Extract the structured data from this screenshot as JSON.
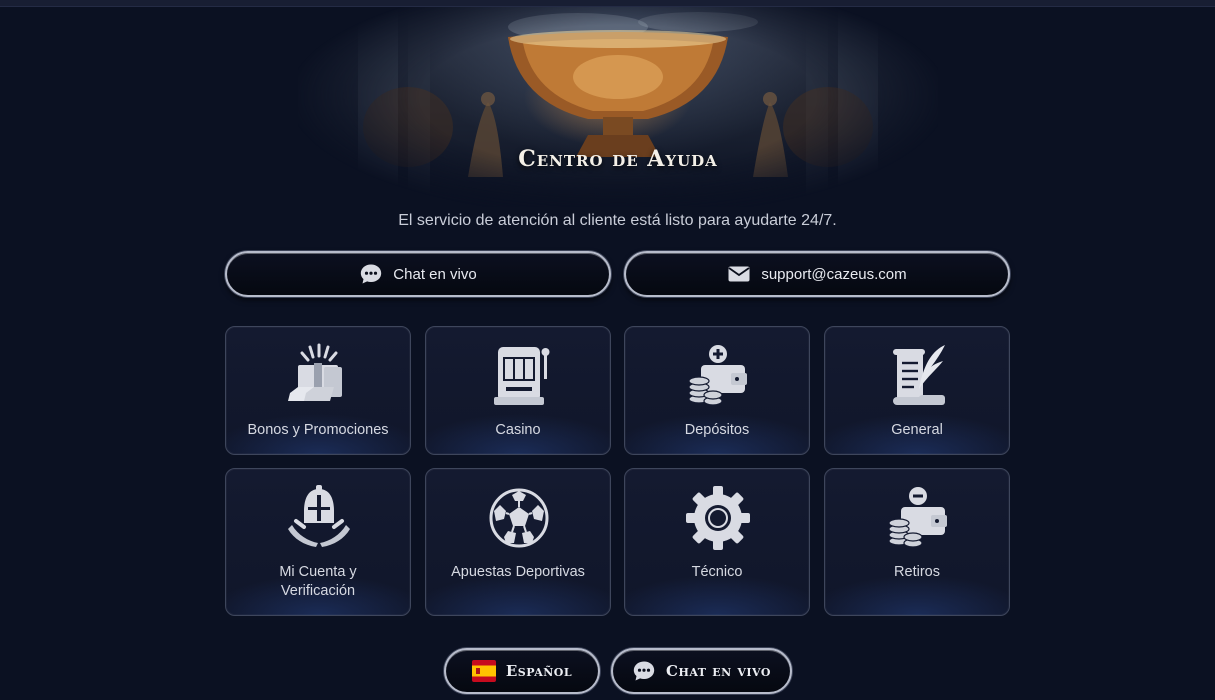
{
  "hero": {
    "title": "Centro de Ayuda"
  },
  "subtitle": "El servicio de atención al cliente está listo para ayudarte 24/7.",
  "contact": {
    "chat_label": "Chat en vivo",
    "chat_icon": "chat-bubble-icon",
    "email_label": "support@cazeus.com",
    "email_icon": "envelope-icon"
  },
  "categories": [
    {
      "label": "Bonos y Promociones",
      "icon": "gift-gold-icon"
    },
    {
      "label": "Casino",
      "icon": "slot-machine-icon"
    },
    {
      "label": "Depósitos",
      "icon": "wallet-plus-icon"
    },
    {
      "label": "General",
      "icon": "scroll-quill-icon"
    },
    {
      "label": "Mi Cuenta y Verificación",
      "icon": "helmet-laurel-icon"
    },
    {
      "label": "Apuestas Deportivas",
      "icon": "soccer-ball-icon"
    },
    {
      "label": "Técnico",
      "icon": "gear-icon"
    },
    {
      "label": "Retiros",
      "icon": "wallet-minus-icon"
    }
  ],
  "footer": {
    "language_label": "Español",
    "language_icon": "spain-flag-icon",
    "chat_label": "Chat en vivo",
    "chat_icon": "chat-bubble-icon"
  },
  "colors": {
    "background": "#0b1122",
    "tile_background": "#141a30",
    "border": "#b7bccb",
    "icon": "#d9dbe3"
  }
}
